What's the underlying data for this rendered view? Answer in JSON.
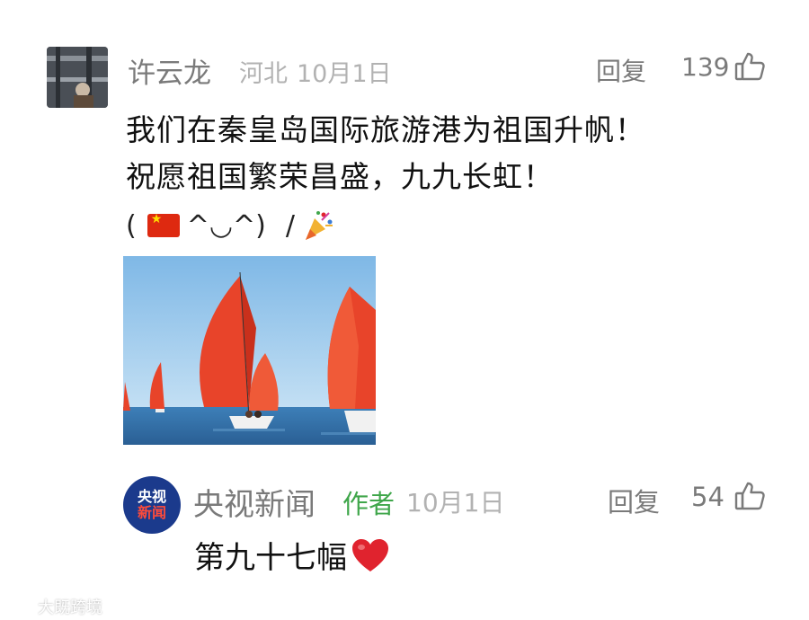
{
  "comment": {
    "user_name": "许云龙",
    "location": "河北",
    "date": "10月1日",
    "reply_label": "回复",
    "likes": "139",
    "lines": [
      "我们在秦皇岛国际旅游港为祖国升帆！",
      "祝愿祖国繁荣昌盛，九九长虹！"
    ],
    "emote_open": "(",
    "emote_face": "^◡^)",
    "emote_slash": "/",
    "image_alt": "red sailboats on sea"
  },
  "author_reply": {
    "avatar_line1": "央视",
    "avatar_line2": "新闻",
    "user_name": "央视新闻",
    "author_tag": "作者",
    "date": "10月1日",
    "reply_label": "回复",
    "likes": "54",
    "text": "第九十七幅"
  },
  "watermark": {
    "text": "大既跨境"
  },
  "colors": {
    "meta_gray": "#b2b2b2",
    "name_gray": "#7a7a7a",
    "author_green": "#3fa64a",
    "heart_red": "#e0232e",
    "sail_red": "#e8442a"
  }
}
